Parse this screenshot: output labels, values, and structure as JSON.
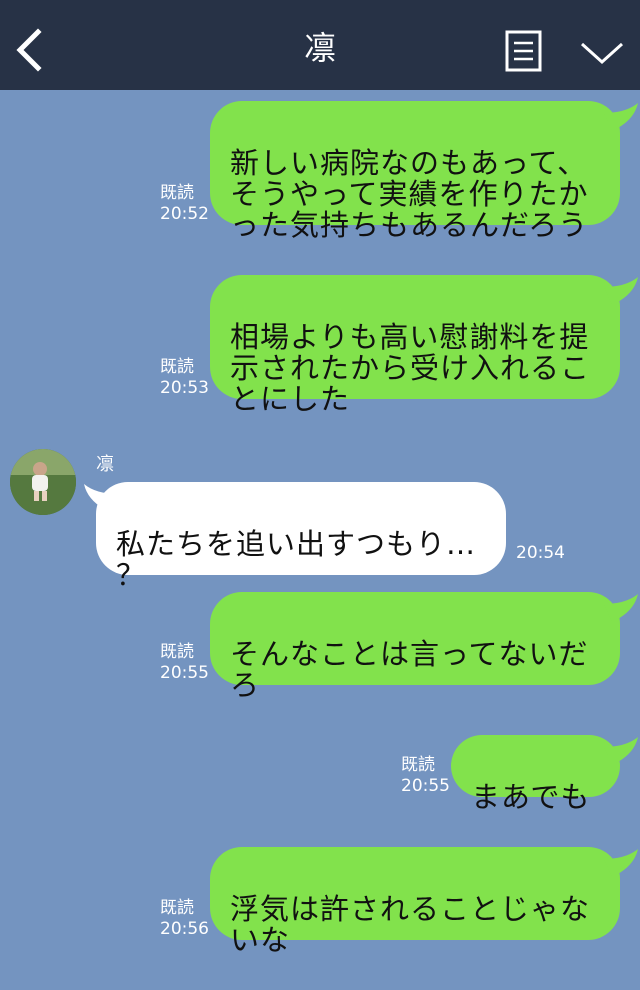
{
  "header": {
    "title": "凛"
  },
  "messages": [
    {
      "text": "新しい病院なのもあって、\nそうやって実績を作りたか\nった気持ちもあるんだろう",
      "read": "既読",
      "time": "20:52"
    },
    {
      "text": "相場よりも高い慰謝料を提\n示されたから受け入れるこ\nとにした",
      "read": "既読",
      "time": "20:53"
    },
    {
      "sender": "凛",
      "text": "私たちを追い出すつもり…\n？",
      "time": "20:54"
    },
    {
      "text": "そんなことは言ってないだ\nろ",
      "read": "既読",
      "time": "20:55"
    },
    {
      "text": "まあでも",
      "read": "既読",
      "time": "20:55"
    },
    {
      "text": "浮気は許されることじゃな\nいな",
      "read": "既読",
      "time": "20:56"
    }
  ],
  "colors": {
    "background": "#7494c0",
    "header": "#273246",
    "sent_bubble": "#82e24c",
    "received_bubble": "#ffffff"
  },
  "icons": [
    "back-arrow-icon",
    "memo-icon",
    "chevron-down-icon"
  ]
}
